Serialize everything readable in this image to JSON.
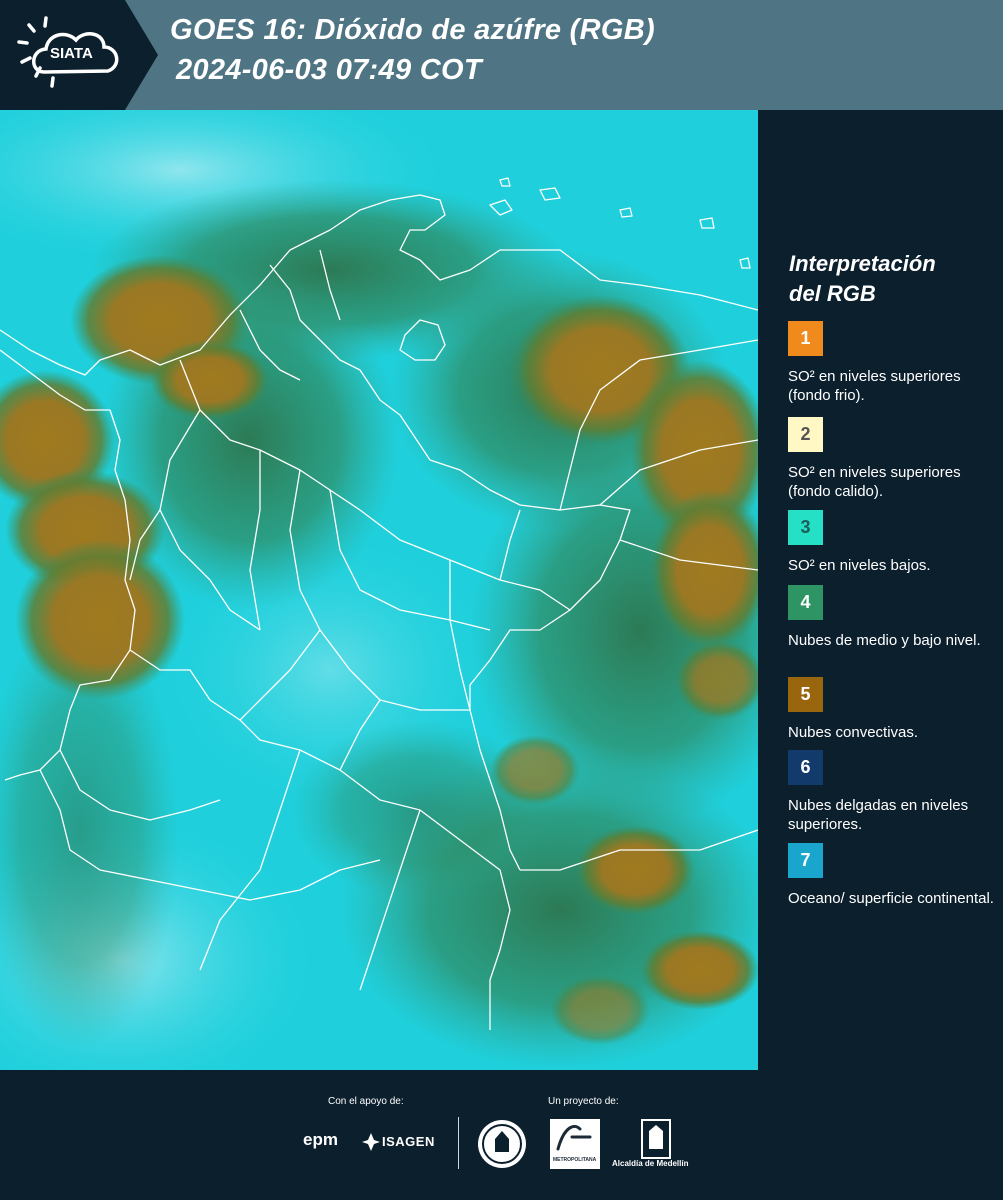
{
  "header": {
    "logo_text": "SIATA",
    "title_line1": "GOES 16: Dióxido de azúfre (RGB)",
    "title_line2": "2024-06-03 07:49 COT"
  },
  "legend": {
    "title_line1": "Interpretación",
    "title_line2": "del RGB",
    "items": [
      {
        "number": "1",
        "color": "#f08a1c",
        "text_color": "#ffffff",
        "label": "SO² en niveles superiores (fondo frio)."
      },
      {
        "number": "2",
        "color": "#fff7c4",
        "text_color": "#555555",
        "label": "SO² en niveles superiores (fondo calido)."
      },
      {
        "number": "3",
        "color": "#26e0c6",
        "text_color": "#1a5f5a",
        "label": "SO² en niveles bajos."
      },
      {
        "number": "4",
        "color": "#2f9464",
        "text_color": "#ffffff",
        "label": "Nubes de medio y bajo nivel."
      },
      {
        "number": "5",
        "color": "#99650d",
        "text_color": "#ffffff",
        "label": "Nubes convectivas."
      },
      {
        "number": "6",
        "color": "#123a6a",
        "text_color": "#ffffff",
        "label": "Nubes delgadas en niveles superiores."
      },
      {
        "number": "7",
        "color": "#1aa6cc",
        "text_color": "#ffffff",
        "label": "Oceano/ superficie continental."
      }
    ]
  },
  "footer": {
    "support_label": "Con el apoyo de:",
    "project_label": "Un proyecto de:",
    "epm": "epm",
    "isagen": "ISAGEN",
    "metropolitana": "METROPOLITANA",
    "alcaldia": "Alcaldía de Medellín"
  }
}
